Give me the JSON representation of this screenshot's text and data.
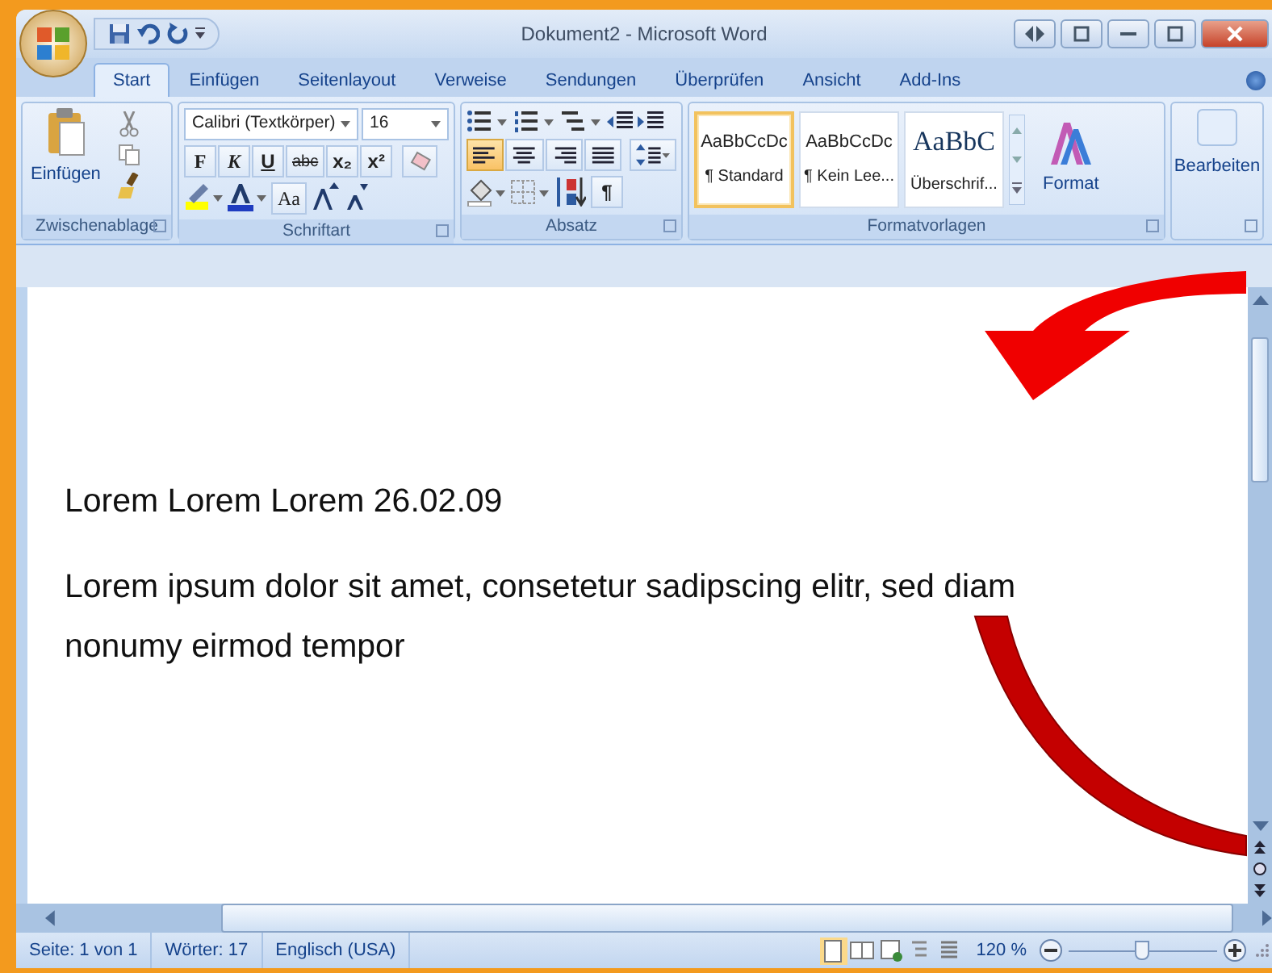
{
  "window": {
    "title": "Dokument2 - Microsoft Word"
  },
  "tabs": [
    {
      "label": "Start",
      "selected": true
    },
    {
      "label": "Einfügen",
      "selected": false
    },
    {
      "label": "Seitenlayout",
      "selected": false
    },
    {
      "label": "Verweise",
      "selected": false
    },
    {
      "label": "Sendungen",
      "selected": false
    },
    {
      "label": "Überprüfen",
      "selected": false
    },
    {
      "label": "Ansicht",
      "selected": false
    },
    {
      "label": "Add-Ins",
      "selected": false
    }
  ],
  "clipboard": {
    "label": "Zwischenablage",
    "paste_button": "Einfügen"
  },
  "font": {
    "label": "Schriftart",
    "font_name": "Calibri (Textkörper)",
    "font_size": "16",
    "format_buttons": [
      "F",
      "K",
      "U",
      "abc",
      "x₂",
      "x²"
    ],
    "case_button": "Aa"
  },
  "paragraph": {
    "label": "Absatz",
    "alignments": [
      {
        "selected": true
      },
      {
        "selected": false
      },
      {
        "selected": false
      },
      {
        "selected": false
      }
    ],
    "pilcrow": "¶"
  },
  "styles": {
    "label": "Formatvorlagen",
    "items": [
      {
        "preview": "AaBbCcDc",
        "name": "¶ Standard",
        "selected": true,
        "kind": "body"
      },
      {
        "preview": "AaBbCcDc",
        "name": "¶ Kein Lee...",
        "selected": false,
        "kind": "body"
      },
      {
        "preview": "AaBbC",
        "name": "Überschrif...",
        "selected": false,
        "kind": "heading"
      }
    ],
    "change_button": "Format"
  },
  "editing": {
    "label": "Bearbeiten"
  },
  "document": {
    "paragraphs": [
      "Lorem Lorem Lorem 26.02.09",
      "Lorem ipsum dolor sit amet, consetetur sadipscing elitr, sed diam nonumy eirmod tempor"
    ]
  },
  "status_bar": {
    "items": [
      "Seite: 1 von 1",
      "Wörter: 17",
      "Englisch (USA)"
    ],
    "views": [
      {
        "selected": true
      },
      {
        "selected": false
      },
      {
        "selected": false
      },
      {
        "selected": false
      },
      {
        "selected": false
      }
    ],
    "zoom": "120 %",
    "zoom_slider": {
      "level": 0.5
    }
  }
}
